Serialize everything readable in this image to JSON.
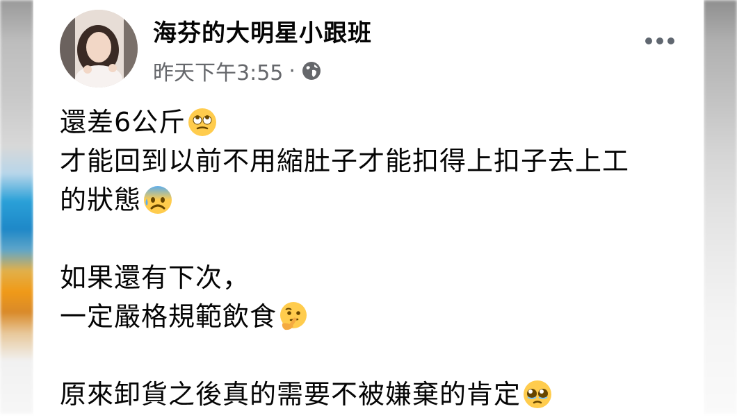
{
  "post": {
    "author": "海芬的大明星小跟班",
    "timestamp": "昨天下午3:55",
    "separator": "·",
    "privacy_icon": "globe-icon",
    "menu_icon": "more-options-icon",
    "lines": [
      {
        "text": "還差6公斤",
        "emoji": "rolling-eyes-emoji"
      },
      {
        "text": "才能回到以前不用縮肚子才能扣得上扣子去上工",
        "emoji": ""
      },
      {
        "text": "的狀態",
        "emoji": "anxious-sweat-emoji"
      },
      {
        "text": "",
        "emoji": ""
      },
      {
        "text": "如果還有下次，",
        "emoji": ""
      },
      {
        "text": "一定嚴格規範飲食",
        "emoji": "thinking-emoji"
      },
      {
        "text": "",
        "emoji": ""
      },
      {
        "text": "原來卸貨之後真的需要不被嫌棄的肯定",
        "emoji": "pleading-emoji"
      }
    ]
  },
  "colors": {
    "text": "#050505",
    "secondary": "#65676b",
    "background": "#ffffff"
  }
}
